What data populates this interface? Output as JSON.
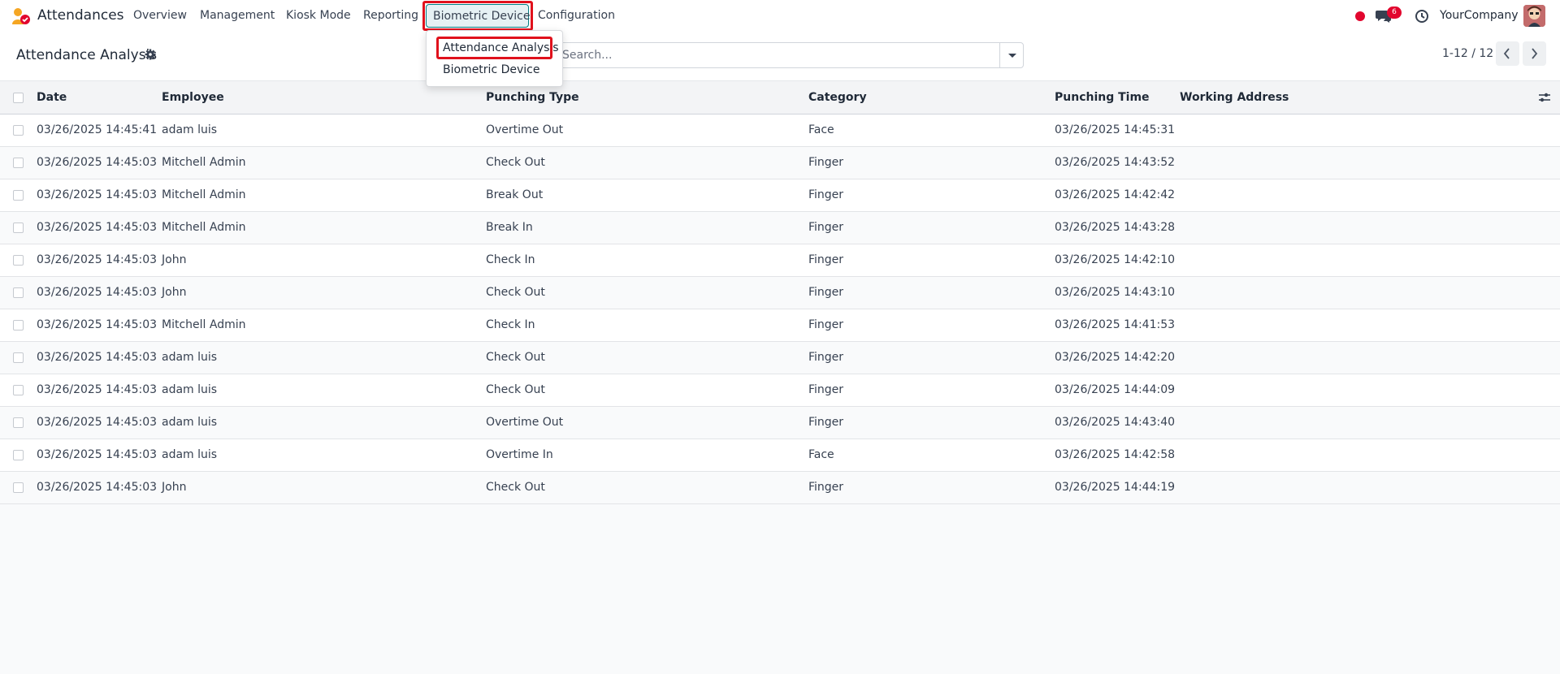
{
  "app": {
    "name": "Attendances",
    "company": "YourCompany",
    "notification_count": "6"
  },
  "menu": [
    {
      "label": "Overview"
    },
    {
      "label": "Management"
    },
    {
      "label": "Kiosk Mode"
    },
    {
      "label": "Reporting"
    },
    {
      "label": "Biometric Device"
    },
    {
      "label": "Configuration"
    }
  ],
  "dropdown": [
    {
      "label": "Attendance Analysis"
    },
    {
      "label": "Biometric Device"
    }
  ],
  "page": {
    "title": "Attendance Analysis"
  },
  "search": {
    "placeholder": "Search..."
  },
  "pager": {
    "text": "1-12 / 12"
  },
  "table": {
    "columns": [
      "Date",
      "Employee",
      "Punching Type",
      "Category",
      "Punching Time",
      "Working Address"
    ],
    "rows": [
      [
        "03/26/2025 14:45:41",
        "adam luis",
        "Overtime Out",
        "Face",
        "03/26/2025 14:45:31",
        ""
      ],
      [
        "03/26/2025 14:45:03",
        "Mitchell Admin",
        "Check Out",
        "Finger",
        "03/26/2025 14:43:52",
        ""
      ],
      [
        "03/26/2025 14:45:03",
        "Mitchell Admin",
        "Break Out",
        "Finger",
        "03/26/2025 14:42:42",
        ""
      ],
      [
        "03/26/2025 14:45:03",
        "Mitchell Admin",
        "Break In",
        "Finger",
        "03/26/2025 14:43:28",
        ""
      ],
      [
        "03/26/2025 14:45:03",
        "John",
        "Check In",
        "Finger",
        "03/26/2025 14:42:10",
        ""
      ],
      [
        "03/26/2025 14:45:03",
        "John",
        "Check Out",
        "Finger",
        "03/26/2025 14:43:10",
        ""
      ],
      [
        "03/26/2025 14:45:03",
        "Mitchell Admin",
        "Check In",
        "Finger",
        "03/26/2025 14:41:53",
        ""
      ],
      [
        "03/26/2025 14:45:03",
        "adam luis",
        "Check Out",
        "Finger",
        "03/26/2025 14:42:20",
        ""
      ],
      [
        "03/26/2025 14:45:03",
        "adam luis",
        "Check Out",
        "Finger",
        "03/26/2025 14:44:09",
        ""
      ],
      [
        "03/26/2025 14:45:03",
        "adam luis",
        "Overtime Out",
        "Finger",
        "03/26/2025 14:43:40",
        ""
      ],
      [
        "03/26/2025 14:45:03",
        "adam luis",
        "Overtime In",
        "Face",
        "03/26/2025 14:42:58",
        ""
      ],
      [
        "03/26/2025 14:45:03",
        "John",
        "Check Out",
        "Finger",
        "03/26/2025 14:44:19",
        ""
      ]
    ]
  },
  "colors": {
    "accent": "#017e84",
    "highlight": "#e0111c",
    "status_dot": "#e2062e"
  }
}
